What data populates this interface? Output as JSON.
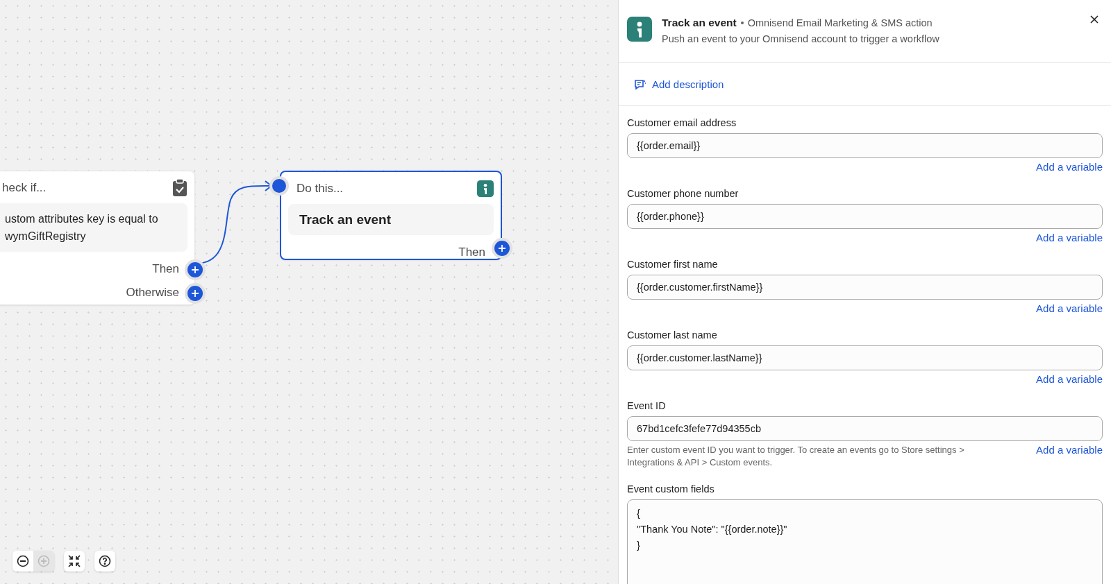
{
  "canvas": {
    "condition_node": {
      "title": "heck if...",
      "condition": "ustom attributes key is equal to\nwymGiftRegistry",
      "outputs": [
        "Then",
        "Otherwise"
      ]
    },
    "action_node": {
      "title": "Do this...",
      "action": "Track an event",
      "output": "Then",
      "selected": true
    },
    "zoom_controls": {
      "zoom_out_disabled": false,
      "zoom_in_disabled": true
    }
  },
  "panel": {
    "title": "Track an event",
    "source": "Omnisend Email Marketing & SMS action",
    "subtitle": "Push an event to your Omnisend account to trigger a workflow",
    "add_description": "Add description",
    "fields": [
      {
        "kind": "input",
        "label": "Customer email address",
        "value": "{{order.email}}",
        "link": "Add a variable"
      },
      {
        "kind": "input",
        "label": "Customer phone number",
        "value": "{{order.phone}}",
        "link": "Add a variable"
      },
      {
        "kind": "input",
        "label": "Customer first name",
        "value": "{{order.customer.firstName}}",
        "link": "Add a variable"
      },
      {
        "kind": "input",
        "label": "Customer last name",
        "value": "{{order.customer.lastName}}",
        "link": "Add a variable"
      },
      {
        "kind": "input",
        "label": "Event ID",
        "value": "67bd1cefc3fefe77d94355cb",
        "hint": "Enter custom event ID you want to trigger. To create an events go to Store settings > Integrations & API > Custom events.",
        "link": "Add a variable"
      },
      {
        "kind": "textarea",
        "label": "Event custom fields",
        "value": "{\n\"Thank You Note\": \"{{order.note}}\"\n}"
      }
    ]
  }
}
